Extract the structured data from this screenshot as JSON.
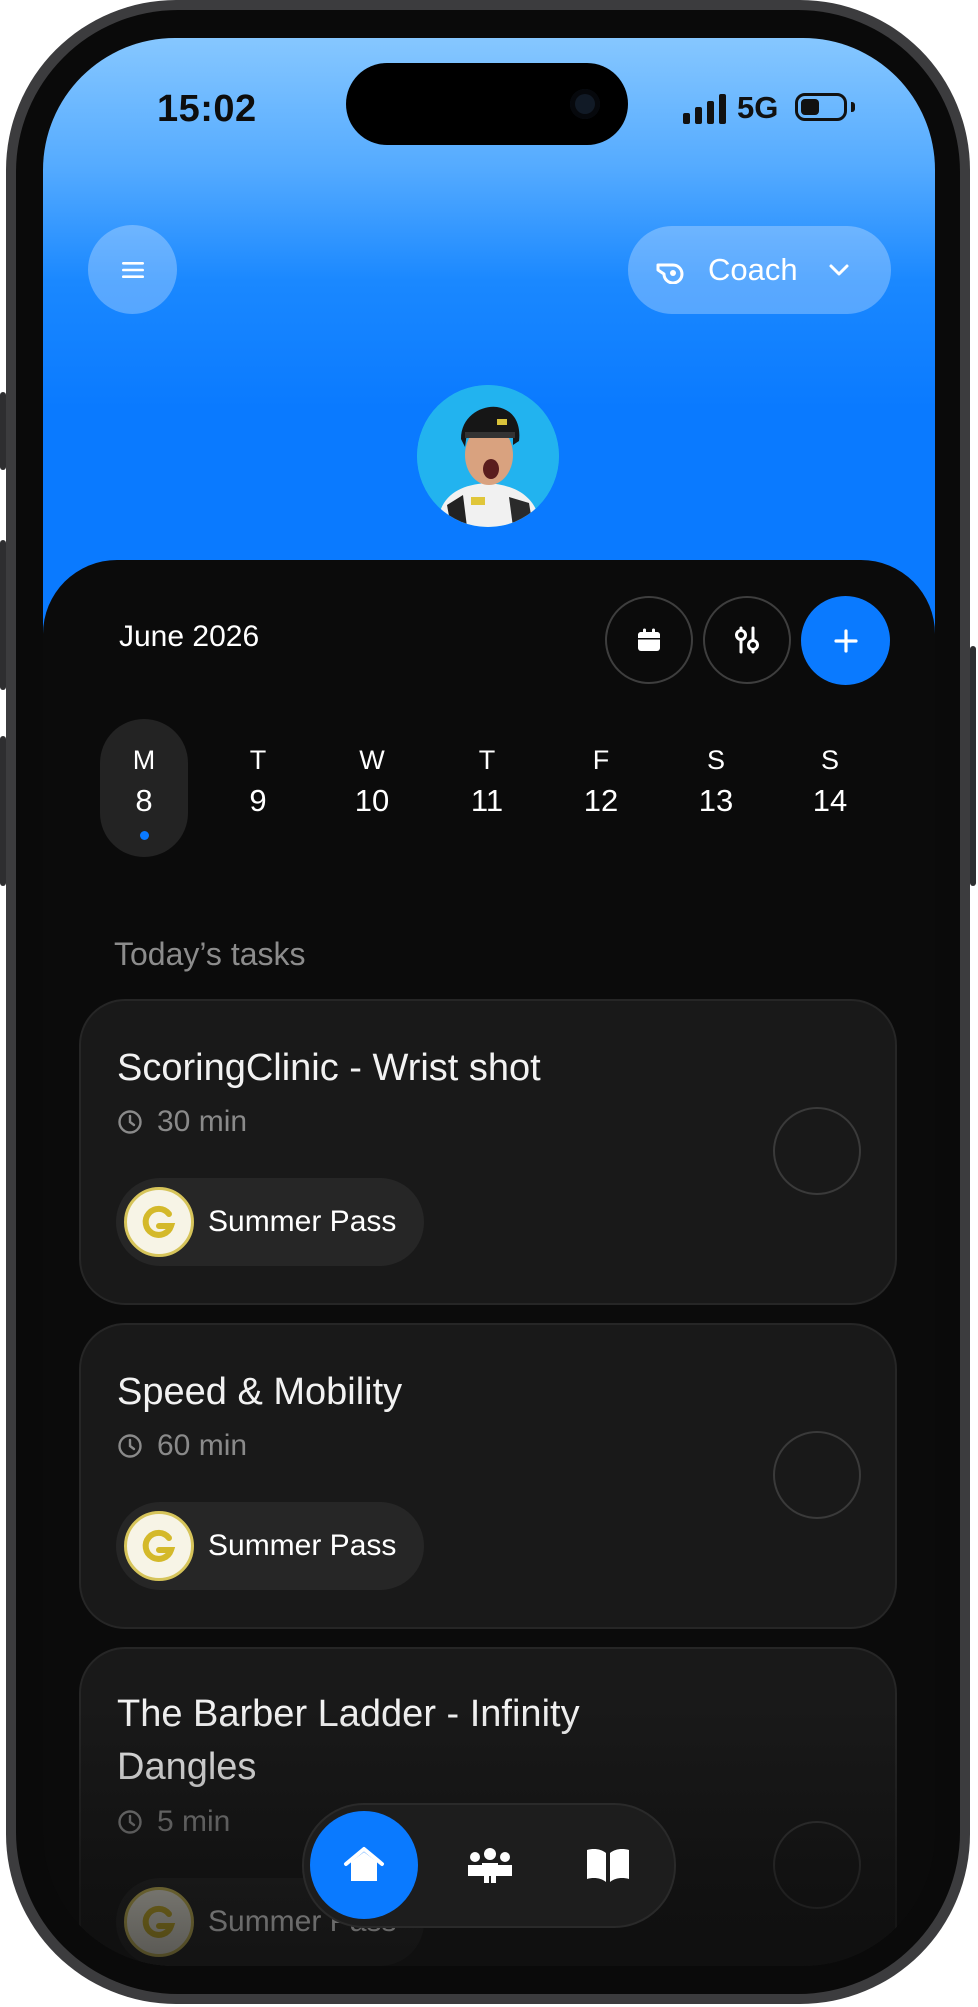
{
  "status_bar": {
    "time": "15:02",
    "network": "5G"
  },
  "header": {
    "role_label": "Coach"
  },
  "calendar": {
    "month_label": "June 2026",
    "selected_index": 0,
    "days": [
      {
        "dow": "M",
        "num": "8"
      },
      {
        "dow": "T",
        "num": "9"
      },
      {
        "dow": "W",
        "num": "10"
      },
      {
        "dow": "T",
        "num": "11"
      },
      {
        "dow": "F",
        "num": "12"
      },
      {
        "dow": "S",
        "num": "13"
      },
      {
        "dow": "S",
        "num": "14"
      }
    ]
  },
  "tasks": {
    "section_title": "Today’s tasks",
    "items": [
      {
        "title_line1": "ScoringClinic - Wrist shot",
        "title_line2": "",
        "duration": "30 min",
        "pass": "Summer Pass"
      },
      {
        "title_line1": "Speed & Mobility",
        "title_line2": "",
        "duration": "60 min",
        "pass": "Summer Pass"
      },
      {
        "title_line1": "The Barber Ladder - Infinity",
        "title_line2": "Dangles",
        "duration": "5 min",
        "pass": "Summer Pass"
      }
    ]
  },
  "nav": {
    "items": [
      "home-icon",
      "team-icon",
      "book-icon"
    ],
    "active": "home-icon"
  },
  "colors": {
    "accent": "#0a7aff",
    "background": "#0b0b0b",
    "card": "#191919",
    "muted_text": "#8c8c8c",
    "badge_gold": "#d6c45a"
  }
}
